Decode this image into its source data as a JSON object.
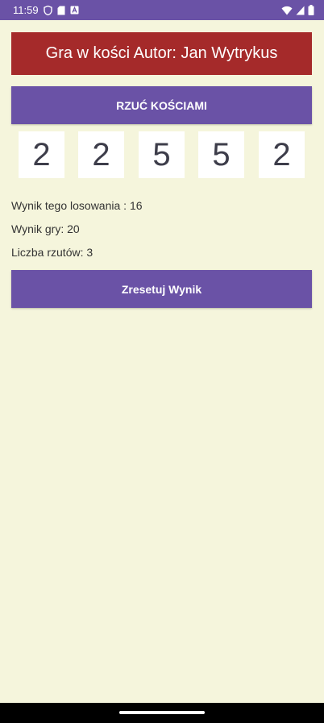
{
  "status_bar": {
    "time": "11:59",
    "left_icons": [
      "shield-icon",
      "sd-card-icon",
      "text-a-icon"
    ],
    "right_icons": [
      "wifi-icon",
      "cell-signal-icon",
      "battery-icon"
    ]
  },
  "header": {
    "title": "Gra w kości Autor: Jan Wytrykus"
  },
  "actions": {
    "roll_label": "RZUĆ KOŚCIAMI",
    "reset_label": "Zresetuj Wynik"
  },
  "dice": [
    "2",
    "2",
    "5",
    "5",
    "2"
  ],
  "results": {
    "round_score": "Wynik tego losowania : 16",
    "game_score": "Wynik gry: 20",
    "roll_count": "Liczba rzutów: 3"
  },
  "colors": {
    "primary": "#6a52a6",
    "title_bg": "#a52a2a",
    "background": "#f5f5dc",
    "die_bg": "#ffffff"
  }
}
